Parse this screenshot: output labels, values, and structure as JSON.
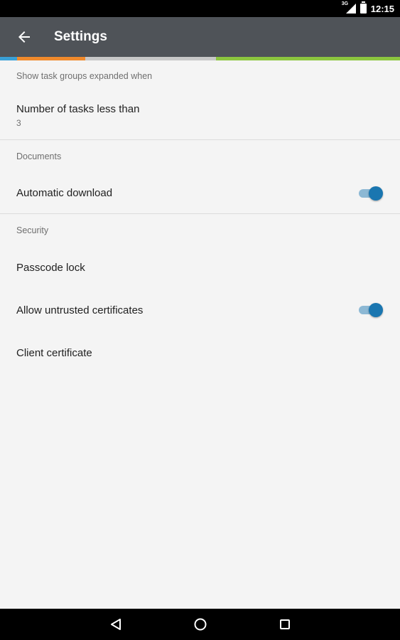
{
  "status_bar": {
    "network": "3G",
    "time": "12:15"
  },
  "app_bar": {
    "title": "Settings",
    "back_icon": "arrow-back-icon"
  },
  "colors": {
    "app_bar": "#4f5358",
    "stripe": [
      "#3aa0d6",
      "#f08a2c",
      "#c8c8c8",
      "#8cc63f"
    ],
    "switch_thumb": "#1a76b0",
    "switch_track": "#8cb8d4"
  },
  "sections": {
    "task_groups": {
      "header": "Show task groups expanded when",
      "item_label": "Number of tasks less than",
      "item_value": "3"
    },
    "documents": {
      "header": "Documents",
      "auto_download_label": "Automatic download",
      "auto_download_on": true
    },
    "security": {
      "header": "Security",
      "passcode_label": "Passcode lock",
      "untrusted_label": "Allow untrusted certificates",
      "untrusted_on": true,
      "client_cert_label": "Client certificate"
    }
  },
  "nav_bar": {
    "back": "nav-back-icon",
    "home": "nav-home-icon",
    "recents": "nav-recents-icon"
  }
}
